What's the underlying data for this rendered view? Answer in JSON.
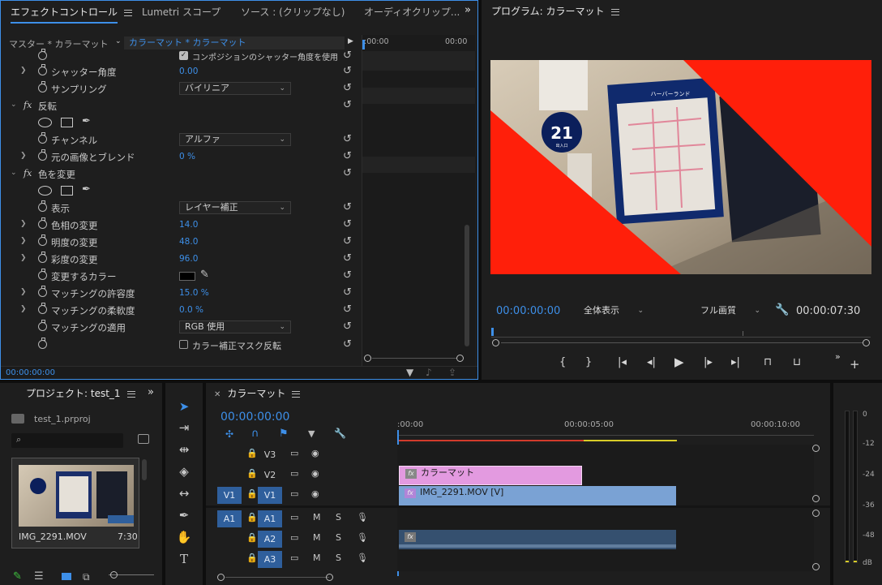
{
  "effect_panel": {
    "tabs": [
      "エフェクトコントロール",
      "Lumetri スコープ",
      "ソース : (クリップなし)",
      "オーディオクリップ..."
    ],
    "source_label": "マスター * カラーマット",
    "clip_label": "カラーマット * カラーマット",
    "ruler_start": ":00:00",
    "ruler_end": "00:00",
    "timecode": "00:00:00:00",
    "shutter_checkbox": "コンポジションのシャッター角度を使用",
    "rows": {
      "shutter_angle": {
        "label": "シャッター角度",
        "value": "0.00"
      },
      "sampling": {
        "label": "サンプリング",
        "value": "バイリニア"
      },
      "invert": {
        "label": "反転"
      },
      "channel": {
        "label": "チャンネル",
        "value": "アルファ"
      },
      "blend": {
        "label": "元の画像とブレンド",
        "value": "0 %"
      },
      "change_color": {
        "label": "色を変更"
      },
      "view": {
        "label": "表示",
        "value": "レイヤー補正"
      },
      "hue": {
        "label": "色相の変更",
        "value": "14.0"
      },
      "lightness": {
        "label": "明度の変更",
        "value": "48.0"
      },
      "saturation": {
        "label": "彩度の変更",
        "value": "96.0"
      },
      "color_to_change": {
        "label": "変更するカラー"
      },
      "tolerance": {
        "label": "マッチングの許容度",
        "value": "15.0 %"
      },
      "softness": {
        "label": "マッチングの柔軟度",
        "value": "0.0 %"
      },
      "match_apply": {
        "label": "マッチングの適用",
        "value": "RGB 使用"
      },
      "invert_mask": {
        "label": "カラー補正マスク反転"
      }
    }
  },
  "program_monitor": {
    "title": "プログラム: カラーマット",
    "timecode": "00:00:00:00",
    "zoom": "全体表示",
    "quality": "フル画質",
    "duration": "00:00:07:30",
    "image_text": {
      "sign_num": "21",
      "sign_small": "出入口",
      "map_title": "ハーバーランド"
    },
    "colors": {
      "matte": "#ff1f0a",
      "accent": "#3d8fe8"
    }
  },
  "project": {
    "title": "プロジェクト: test_1",
    "file": "test_1.prproj",
    "clip_name": "IMG_2291.MOV",
    "clip_duration": "7:30"
  },
  "timeline": {
    "title": "カラーマット",
    "timecode": "00:00:00:00",
    "ruler": [
      ":00:00",
      "00:00:05:00",
      "00:00:10:00"
    ],
    "tracks": {
      "v3": "V3",
      "v2": "V2",
      "v1_src": "V1",
      "v1": "V1",
      "a1_src": "A1",
      "a1": "A1",
      "a2": "A2",
      "a3": "A3",
      "m": "M",
      "s": "S"
    },
    "clips": {
      "matte": "カラーマット",
      "video": "IMG_2291.MOV [V]",
      "fx": "fx"
    }
  },
  "meter": {
    "labels": [
      "0",
      "-12",
      "-24",
      "-36",
      "-48",
      "dB"
    ]
  }
}
